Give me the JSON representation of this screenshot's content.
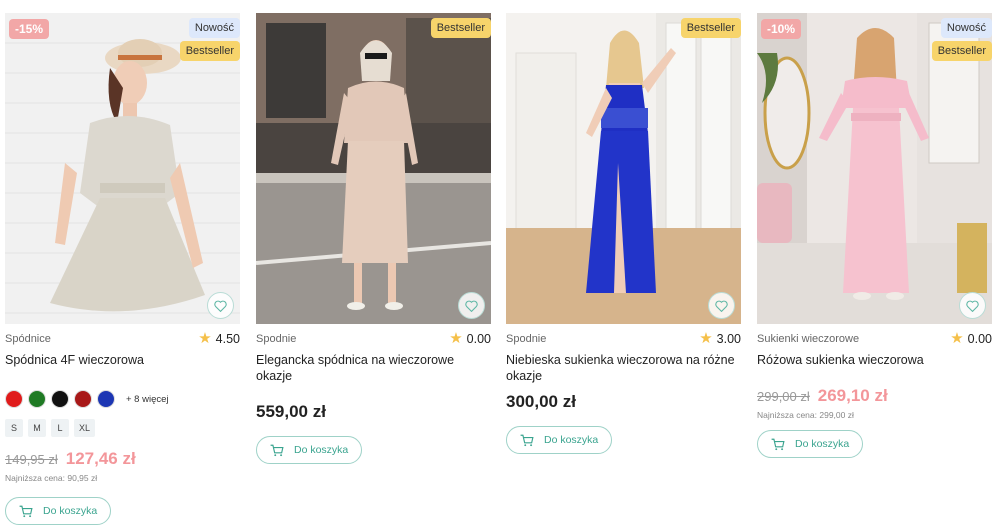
{
  "products": [
    {
      "category": "Spódnice",
      "rating": "4.50",
      "title": "Spódnica 4F wieczorowa",
      "badges": {
        "discount": "-15%",
        "new": "Nowość",
        "bestseller": "Bestseller"
      },
      "colors": [
        "#e01b1b",
        "#1f7a24",
        "#111111",
        "#a81818",
        "#1c36b3"
      ],
      "more_colors": "+ 8 więcej",
      "sizes": [
        "S",
        "M",
        "L",
        "XL"
      ],
      "old_price": "149,95 zł",
      "price": "127,46 zł",
      "lowest_price": "Najniższa cena: 90,95 zł",
      "cart_label": "Do koszyka"
    },
    {
      "category": "Spodnie",
      "rating": "0.00",
      "title": "Elegancka spódnica na wieczorowe okazje",
      "badges": {
        "bestseller": "Bestseller"
      },
      "price": "559,00 zł",
      "cart_label": "Do koszyka"
    },
    {
      "category": "Spodnie",
      "rating": "3.00",
      "title": "Niebieska sukienka wieczorowa na różne okazje",
      "badges": {
        "bestseller": "Bestseller"
      },
      "price": "300,00 zł",
      "cart_label": "Do koszyka"
    },
    {
      "category": "Sukienki wieczorowe",
      "rating": "0.00",
      "title": "Różowa sukienka wieczorowa",
      "badges": {
        "discount": "-10%",
        "new": "Nowość",
        "bestseller": "Bestseller"
      },
      "old_price": "299,00 zł",
      "price": "269,10 zł",
      "lowest_price": "Najniższa cena: 299,00 zł",
      "cart_label": "Do koszyka"
    }
  ],
  "icons": {
    "favorite": "heart-icon",
    "cart": "cart-icon",
    "rating": "star-icon"
  },
  "colors": {
    "accent": "#3aa48f",
    "sale": "#f3969a",
    "bestseller_badge": "#f7d46b",
    "new_badge": "#dde8fb",
    "discount_badge": "#f2a7a7"
  }
}
